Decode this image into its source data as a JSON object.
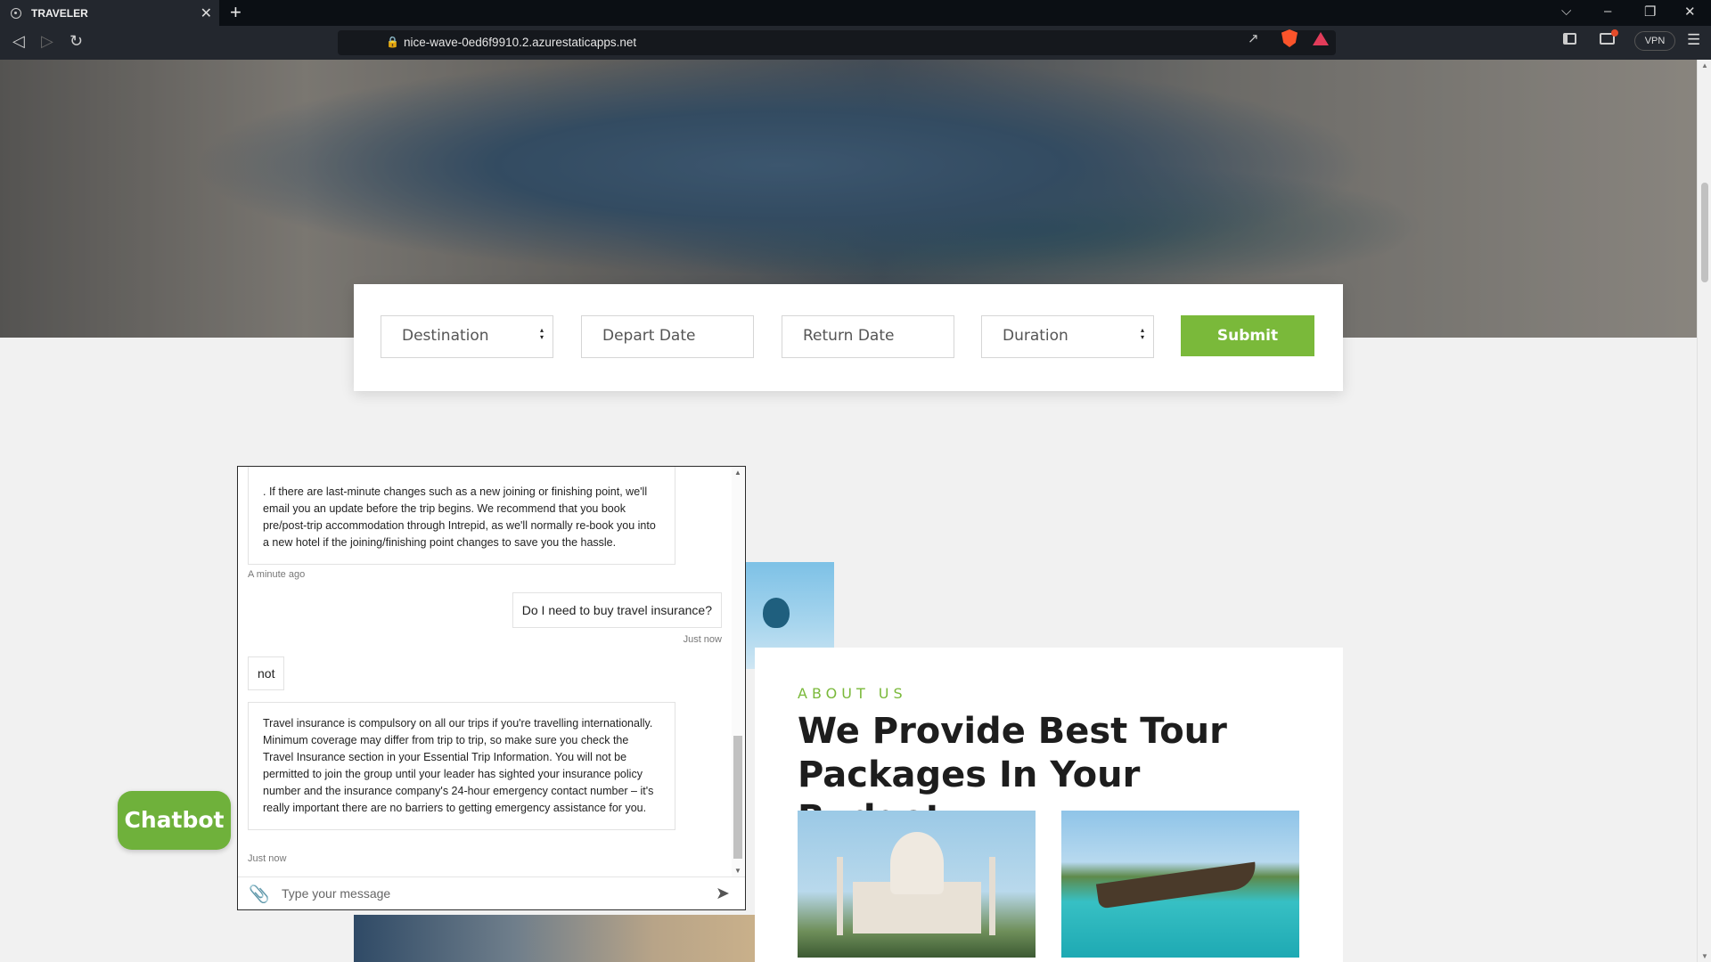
{
  "browser": {
    "tab_title": "TRAVELER",
    "tab_close": "✕",
    "new_tab": "+",
    "url": "nice-wave-0ed6f9910.2.azurestaticapps.net",
    "vpn_label": "VPN",
    "window_controls": {
      "dropdown": "⌵",
      "minimize": "–",
      "restore": "❐",
      "close": "✕"
    }
  },
  "search_form": {
    "destination": "Destination",
    "depart_placeholder": "Depart Date",
    "return_placeholder": "Return Date",
    "duration": "Duration",
    "submit_label": "Submit"
  },
  "about": {
    "subtitle": "ABOUT US",
    "title": "We Provide Best Tour Packages In Your Budget"
  },
  "chat": {
    "messages": {
      "bot_1": ". If there are last-minute changes such as a new joining or finishing point, we'll email you an update before the trip begins. We recommend that you book pre/post-trip accommodation through Intrepid, as we'll normally re-book you into a new hotel if the joining/finishing point changes to save you the hassle.",
      "bot_1_time": "A minute ago",
      "user_1": "Do I need to buy travel insurance?",
      "user_1_time": "Just now",
      "bot_2": "not",
      "bot_3": "Travel insurance is compulsory on all our trips if you're travelling internationally. Minimum coverage may differ from trip to trip, so make sure you check the Travel Insurance section in your Essential Trip Information. You will not be permitted to join the group until your leader has sighted your insurance policy number and the insurance company's 24-hour emergency contact number – it's really important there are no barriers to getting emergency assistance for you.",
      "bot_3_time": "Just now"
    },
    "input_placeholder": "Type your message",
    "launcher_label": "Chatbot"
  },
  "icons": {
    "back": "back-arrow-icon",
    "forward": "forward-arrow-icon",
    "reload": "reload-icon",
    "attach": "paperclip-icon",
    "send": "send-icon"
  },
  "colors": {
    "accent_green": "#7ab93a",
    "chrome_dark": "#23272e"
  }
}
